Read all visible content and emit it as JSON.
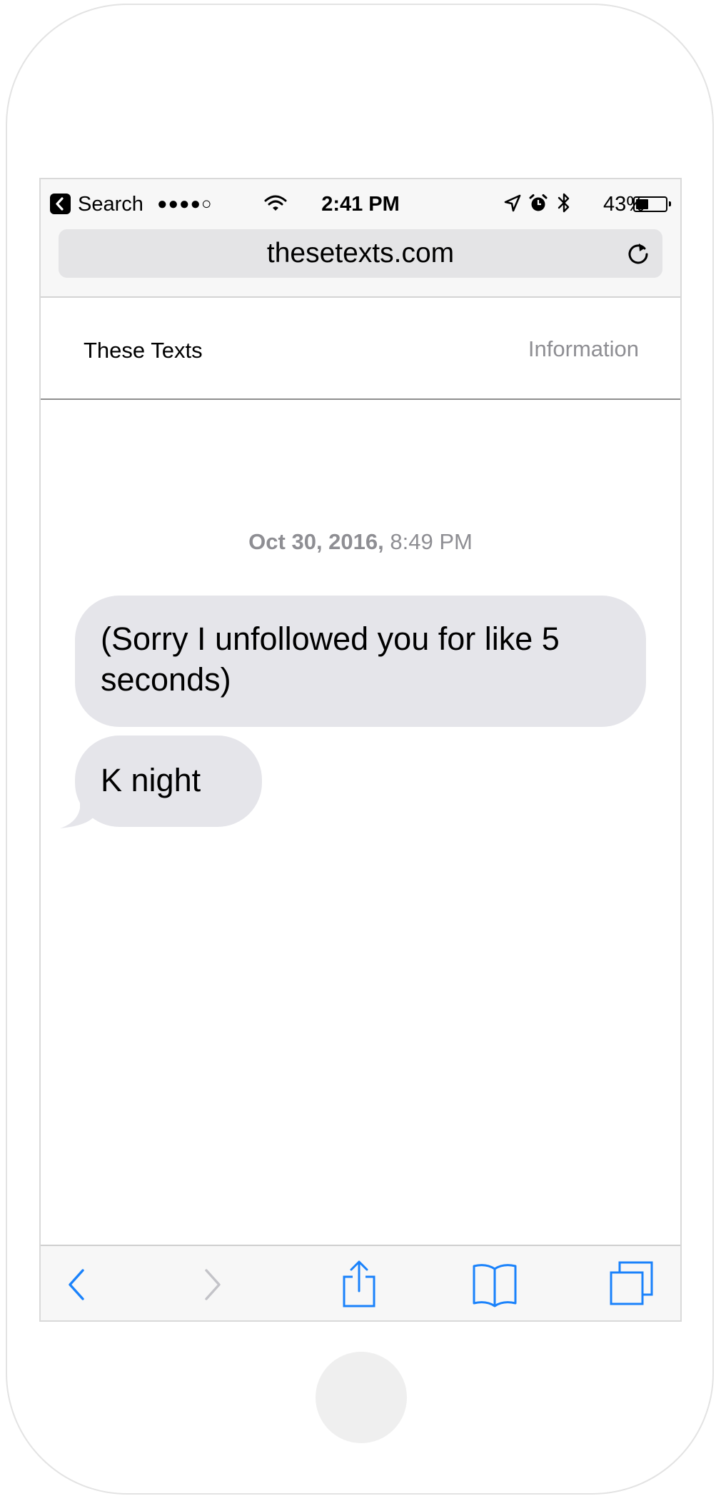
{
  "status_bar": {
    "back_label": "Search",
    "signal": "●●●●○",
    "time": "2:41 PM",
    "battery_percent": "43%",
    "battery_level": 0.43
  },
  "browser": {
    "url": "thesetexts.com"
  },
  "site": {
    "title": "These Texts",
    "info_link": "Information"
  },
  "conversation": {
    "date": "Oct 30, 2016,",
    "time": "8:49 PM",
    "messages": [
      {
        "text": "(Sorry I unfollowed you for like 5 seconds)"
      },
      {
        "text": "K night"
      }
    ]
  },
  "colors": {
    "bubble_gray": "#e5e5ea",
    "ios_blue": "#1a82fb",
    "secondary_text": "#8e8e93"
  },
  "icons": {
    "back_app": "chevron-left-icon",
    "wifi": "wifi-icon",
    "location": "location-arrow-icon",
    "alarm": "alarm-clock-icon",
    "bluetooth": "bluetooth-icon",
    "battery": "battery-icon",
    "reload": "reload-icon",
    "toolbar": [
      "chevron-left-icon",
      "chevron-right-icon",
      "share-icon",
      "bookmarks-icon",
      "tabs-icon"
    ]
  }
}
